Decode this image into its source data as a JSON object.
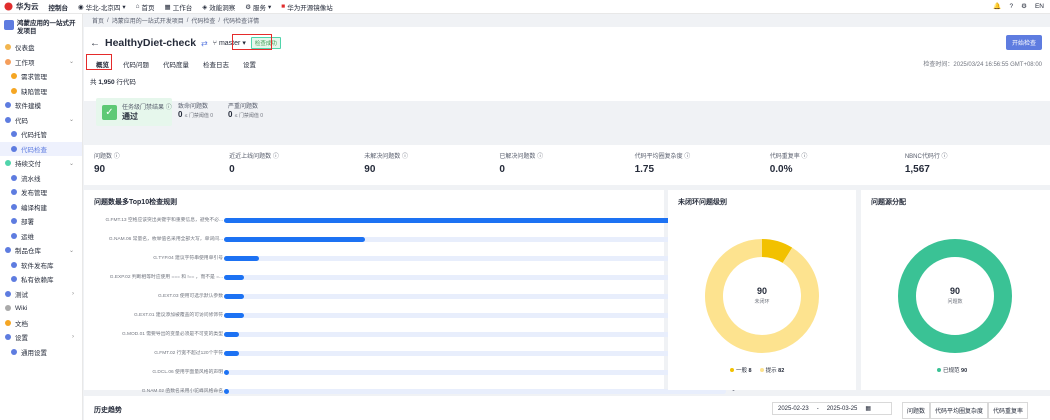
{
  "topbar": {
    "brand": "华为云",
    "console": "控制台",
    "region": "华北-北京四",
    "nav": [
      "首页",
      "工作台",
      "效能洞察",
      "服务",
      "华为开源镜像站"
    ],
    "notif_count": "1",
    "lang": "EN"
  },
  "sidebar": {
    "project": "鸿蒙应用的一站式开发项目",
    "items": [
      {
        "label": "仪表盘",
        "sub": false,
        "color": "#f2b54f",
        "chev": ""
      },
      {
        "label": "工作项",
        "sub": false,
        "color": "#f59e5b",
        "chev": "v"
      },
      {
        "label": "需求管理",
        "sub": true,
        "color": "#f5a623",
        "chev": ""
      },
      {
        "label": "缺陷管理",
        "sub": true,
        "color": "#f5a623",
        "chev": ""
      },
      {
        "label": "软件建模",
        "sub": false,
        "color": "#5e7ce0",
        "chev": ""
      },
      {
        "label": "代码",
        "sub": false,
        "color": "#5e7ce0",
        "chev": "v"
      },
      {
        "label": "代码托管",
        "sub": true,
        "color": "#5e7ce0",
        "chev": ""
      },
      {
        "label": "代码检查",
        "sub": true,
        "color": "#5e7ce0",
        "chev": "",
        "active": true
      },
      {
        "label": "持续交付",
        "sub": false,
        "color": "#50d4ab",
        "chev": "v"
      },
      {
        "label": "流水线",
        "sub": true,
        "color": "#5e7ce0",
        "chev": ""
      },
      {
        "label": "发布管理",
        "sub": true,
        "color": "#5e7ce0",
        "chev": ""
      },
      {
        "label": "编译构建",
        "sub": true,
        "color": "#5e7ce0",
        "chev": ""
      },
      {
        "label": "部署",
        "sub": true,
        "color": "#5e7ce0",
        "chev": ""
      },
      {
        "label": "运维",
        "sub": true,
        "color": "#5e7ce0",
        "chev": ""
      },
      {
        "label": "制品仓库",
        "sub": false,
        "color": "#5e7ce0",
        "chev": "v"
      },
      {
        "label": "软件发布库",
        "sub": true,
        "color": "#5e7ce0",
        "chev": ""
      },
      {
        "label": "私有依赖库",
        "sub": true,
        "color": "#5e7ce0",
        "chev": ""
      },
      {
        "label": "测试",
        "sub": false,
        "color": "#5e7ce0",
        "chev": ">"
      },
      {
        "label": "Wiki",
        "sub": false,
        "color": "#aaa",
        "chev": ""
      },
      {
        "label": "文档",
        "sub": false,
        "color": "#f5a623",
        "chev": ""
      },
      {
        "label": "设置",
        "sub": false,
        "color": "#5e7ce0",
        "chev": ">"
      },
      {
        "label": "通用设置",
        "sub": true,
        "color": "#5e7ce0",
        "chev": ""
      }
    ]
  },
  "breadcrumb": [
    "首页",
    "鸿蒙应用的一站式开发项目",
    "代码检查",
    "代码检查详情"
  ],
  "header": {
    "title": "HealthyDiet-check",
    "branch": "master",
    "status": "检查成功",
    "start_btn": "开始检查",
    "tabs": [
      "概览",
      "代码问题",
      "代码度量",
      "检查日志",
      "设置"
    ],
    "check_time": "检查时间：2025/03/24 16:56:55 GMT+08:00",
    "total_pre": "共",
    "total_num": "1,950",
    "total_post": "行代码"
  },
  "gate": {
    "label": "任务级门禁结果",
    "result": "通过",
    "c1_label": "致命问题数",
    "c1_val": "0",
    "c1_sub": "≤ 门禁阈值 0",
    "c2_label": "严重问题数",
    "c2_val": "0",
    "c2_sub": "≤ 门禁阈值 0"
  },
  "stats": [
    {
      "label": "问题数",
      "value": "90"
    },
    {
      "label": "近近上线问题数",
      "value": "0"
    },
    {
      "label": "未解决问题数",
      "value": "90"
    },
    {
      "label": "已解决问题数",
      "value": "0"
    },
    {
      "label": "代码平均圈复杂度",
      "value": "1.75"
    },
    {
      "label": "代码重复率",
      "value": "0.0%"
    },
    {
      "label": "NBNC代码行",
      "value": "1,567"
    }
  ],
  "chart_data": [
    {
      "type": "bar",
      "title": "问题数最多Top10检查规则",
      "categories": [
        "G.FMT.13 空格应该突出关键字和重要信息，避免不必...",
        "G.NAM.06 常量名，枚举值名采用全部大写，单词间...",
        "G.TYP.04 建议字符串使用单引号",
        "G.EXP.02 判断相等时应使用 === 和 !== ，而不是 =...",
        "G.EXT.03 使用可选示默认参数",
        "G.EXT.01 建议添加被覆盖的可访问修饰符",
        "G.MOD.01 需要导出的变量必须是不可变的类型",
        "G.FMT.02 行宽不超过120个字符",
        "G.DCL.06 使用字面量风格的声明",
        "G.NAM.02 函数名采用小驼峰风格命名"
      ],
      "values": [
        94,
        28,
        7,
        4,
        4,
        4,
        3,
        3,
        1,
        1
      ],
      "xlim": [
        0,
        100
      ]
    },
    {
      "type": "pie",
      "title": "未闭环问题级别",
      "center_value": "90",
      "center_label": "未闭环",
      "slices": [
        {
          "name": "一般",
          "value": 8,
          "color": "#f2c100"
        },
        {
          "name": "提示",
          "value": 82,
          "color": "#fde38f"
        }
      ]
    },
    {
      "type": "pie",
      "title": "问题源分配",
      "center_value": "90",
      "center_label": "问题数",
      "slices": [
        {
          "name": "已规范",
          "value": 90,
          "color": "#3ac295"
        }
      ]
    }
  ],
  "history": {
    "title": "历史趋势",
    "date_from": "2025-02-23",
    "date_to": "2025-03-25",
    "tabs": [
      "问题数",
      "代码平均圈复杂度",
      "代码重复率"
    ]
  }
}
